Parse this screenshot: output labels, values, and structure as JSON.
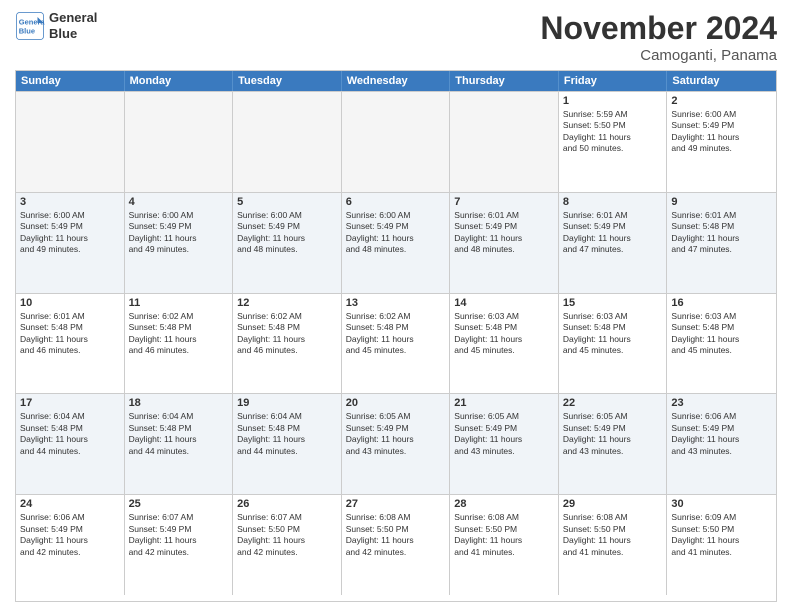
{
  "logo": {
    "line1": "General",
    "line2": "Blue"
  },
  "title": "November 2024",
  "location": "Camoganti, Panama",
  "header": {
    "days": [
      "Sunday",
      "Monday",
      "Tuesday",
      "Wednesday",
      "Thursday",
      "Friday",
      "Saturday"
    ]
  },
  "weeks": [
    [
      {
        "day": "",
        "empty": true
      },
      {
        "day": "",
        "empty": true
      },
      {
        "day": "",
        "empty": true
      },
      {
        "day": "",
        "empty": true
      },
      {
        "day": "",
        "empty": true
      },
      {
        "day": "1",
        "lines": [
          "Sunrise: 5:59 AM",
          "Sunset: 5:50 PM",
          "Daylight: 11 hours",
          "and 50 minutes."
        ]
      },
      {
        "day": "2",
        "lines": [
          "Sunrise: 6:00 AM",
          "Sunset: 5:49 PM",
          "Daylight: 11 hours",
          "and 49 minutes."
        ]
      }
    ],
    [
      {
        "day": "3",
        "lines": [
          "Sunrise: 6:00 AM",
          "Sunset: 5:49 PM",
          "Daylight: 11 hours",
          "and 49 minutes."
        ]
      },
      {
        "day": "4",
        "lines": [
          "Sunrise: 6:00 AM",
          "Sunset: 5:49 PM",
          "Daylight: 11 hours",
          "and 49 minutes."
        ]
      },
      {
        "day": "5",
        "lines": [
          "Sunrise: 6:00 AM",
          "Sunset: 5:49 PM",
          "Daylight: 11 hours",
          "and 48 minutes."
        ]
      },
      {
        "day": "6",
        "lines": [
          "Sunrise: 6:00 AM",
          "Sunset: 5:49 PM",
          "Daylight: 11 hours",
          "and 48 minutes."
        ]
      },
      {
        "day": "7",
        "lines": [
          "Sunrise: 6:01 AM",
          "Sunset: 5:49 PM",
          "Daylight: 11 hours",
          "and 48 minutes."
        ]
      },
      {
        "day": "8",
        "lines": [
          "Sunrise: 6:01 AM",
          "Sunset: 5:49 PM",
          "Daylight: 11 hours",
          "and 47 minutes."
        ]
      },
      {
        "day": "9",
        "lines": [
          "Sunrise: 6:01 AM",
          "Sunset: 5:48 PM",
          "Daylight: 11 hours",
          "and 47 minutes."
        ]
      }
    ],
    [
      {
        "day": "10",
        "lines": [
          "Sunrise: 6:01 AM",
          "Sunset: 5:48 PM",
          "Daylight: 11 hours",
          "and 46 minutes."
        ]
      },
      {
        "day": "11",
        "lines": [
          "Sunrise: 6:02 AM",
          "Sunset: 5:48 PM",
          "Daylight: 11 hours",
          "and 46 minutes."
        ]
      },
      {
        "day": "12",
        "lines": [
          "Sunrise: 6:02 AM",
          "Sunset: 5:48 PM",
          "Daylight: 11 hours",
          "and 46 minutes."
        ]
      },
      {
        "day": "13",
        "lines": [
          "Sunrise: 6:02 AM",
          "Sunset: 5:48 PM",
          "Daylight: 11 hours",
          "and 45 minutes."
        ]
      },
      {
        "day": "14",
        "lines": [
          "Sunrise: 6:03 AM",
          "Sunset: 5:48 PM",
          "Daylight: 11 hours",
          "and 45 minutes."
        ]
      },
      {
        "day": "15",
        "lines": [
          "Sunrise: 6:03 AM",
          "Sunset: 5:48 PM",
          "Daylight: 11 hours",
          "and 45 minutes."
        ]
      },
      {
        "day": "16",
        "lines": [
          "Sunrise: 6:03 AM",
          "Sunset: 5:48 PM",
          "Daylight: 11 hours",
          "and 45 minutes."
        ]
      }
    ],
    [
      {
        "day": "17",
        "lines": [
          "Sunrise: 6:04 AM",
          "Sunset: 5:48 PM",
          "Daylight: 11 hours",
          "and 44 minutes."
        ]
      },
      {
        "day": "18",
        "lines": [
          "Sunrise: 6:04 AM",
          "Sunset: 5:48 PM",
          "Daylight: 11 hours",
          "and 44 minutes."
        ]
      },
      {
        "day": "19",
        "lines": [
          "Sunrise: 6:04 AM",
          "Sunset: 5:48 PM",
          "Daylight: 11 hours",
          "and 44 minutes."
        ]
      },
      {
        "day": "20",
        "lines": [
          "Sunrise: 6:05 AM",
          "Sunset: 5:49 PM",
          "Daylight: 11 hours",
          "and 43 minutes."
        ]
      },
      {
        "day": "21",
        "lines": [
          "Sunrise: 6:05 AM",
          "Sunset: 5:49 PM",
          "Daylight: 11 hours",
          "and 43 minutes."
        ]
      },
      {
        "day": "22",
        "lines": [
          "Sunrise: 6:05 AM",
          "Sunset: 5:49 PM",
          "Daylight: 11 hours",
          "and 43 minutes."
        ]
      },
      {
        "day": "23",
        "lines": [
          "Sunrise: 6:06 AM",
          "Sunset: 5:49 PM",
          "Daylight: 11 hours",
          "and 43 minutes."
        ]
      }
    ],
    [
      {
        "day": "24",
        "lines": [
          "Sunrise: 6:06 AM",
          "Sunset: 5:49 PM",
          "Daylight: 11 hours",
          "and 42 minutes."
        ]
      },
      {
        "day": "25",
        "lines": [
          "Sunrise: 6:07 AM",
          "Sunset: 5:49 PM",
          "Daylight: 11 hours",
          "and 42 minutes."
        ]
      },
      {
        "day": "26",
        "lines": [
          "Sunrise: 6:07 AM",
          "Sunset: 5:50 PM",
          "Daylight: 11 hours",
          "and 42 minutes."
        ]
      },
      {
        "day": "27",
        "lines": [
          "Sunrise: 6:08 AM",
          "Sunset: 5:50 PM",
          "Daylight: 11 hours",
          "and 42 minutes."
        ]
      },
      {
        "day": "28",
        "lines": [
          "Sunrise: 6:08 AM",
          "Sunset: 5:50 PM",
          "Daylight: 11 hours",
          "and 41 minutes."
        ]
      },
      {
        "day": "29",
        "lines": [
          "Sunrise: 6:08 AM",
          "Sunset: 5:50 PM",
          "Daylight: 11 hours",
          "and 41 minutes."
        ]
      },
      {
        "day": "30",
        "lines": [
          "Sunrise: 6:09 AM",
          "Sunset: 5:50 PM",
          "Daylight: 11 hours",
          "and 41 minutes."
        ]
      }
    ]
  ]
}
